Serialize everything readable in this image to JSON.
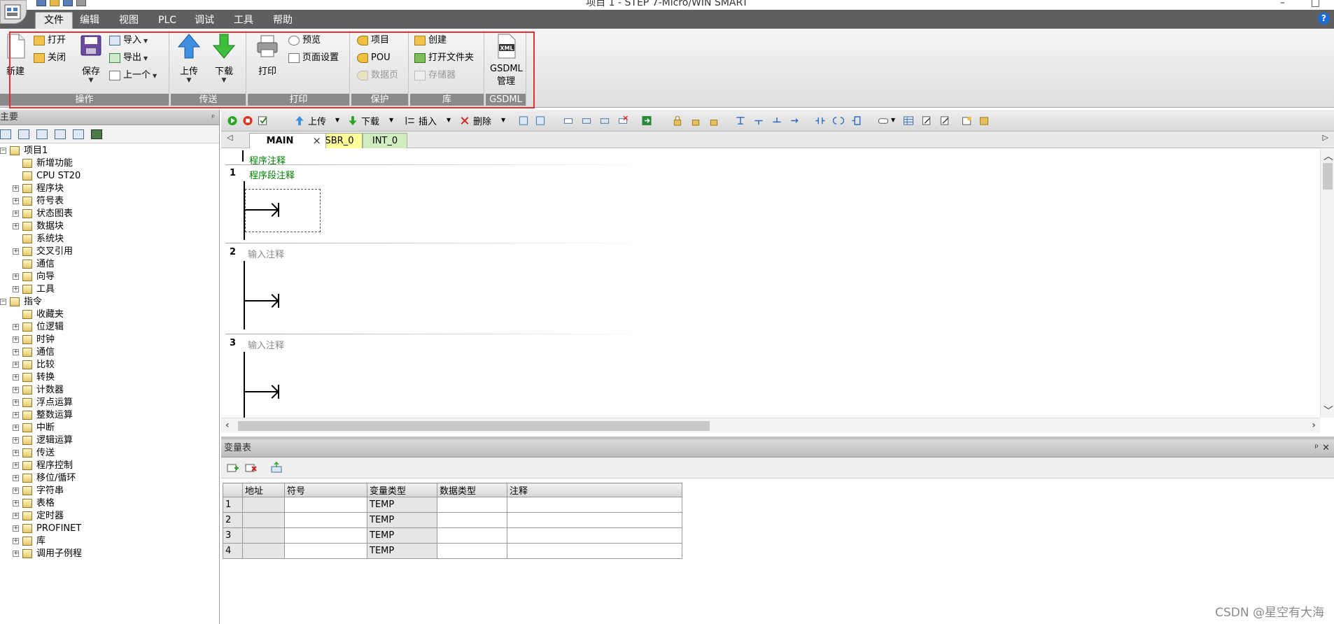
{
  "window": {
    "title": "项目 1 - STEP 7-Micro/WIN SMART",
    "minimize": "–",
    "maximize": "□",
    "help": "?"
  },
  "menu": {
    "items": [
      "文件",
      "编辑",
      "视图",
      "PLC",
      "调试",
      "工具",
      "帮助"
    ],
    "active": "文件"
  },
  "ribbon": {
    "groups": {
      "operate": "操作",
      "transfer": "传送",
      "print": "打印",
      "protect": "保护",
      "library": "库",
      "gsdml": "GSDML"
    },
    "new_label": "新建",
    "open_label": "打开",
    "close_label": "关闭",
    "save_label": "保存",
    "import_label": "导入",
    "export_label": "导出",
    "prev_label": "上一个",
    "upload_label": "上传",
    "download_label": "下载",
    "print_label": "打印",
    "preview_label": "预览",
    "page_setup_label": "页面设置",
    "project_label": "项目",
    "pou_label": "POU",
    "datapage_label": "数据页",
    "create_label": "创建",
    "open_folder_label": "打开文件夹",
    "memory_label": "存储器",
    "gsdml_line1": "GSDML",
    "gsdml_line2": "管理",
    "xml_badge": "XML"
  },
  "left_panel": {
    "title": "主要",
    "pin": "ᵖ",
    "tree": [
      {
        "label": "项目1",
        "level": 0,
        "expander": "−"
      },
      {
        "label": "新增功能",
        "level": 1,
        "expander": ""
      },
      {
        "label": "CPU ST20",
        "level": 1,
        "expander": ""
      },
      {
        "label": "程序块",
        "level": 1,
        "expander": "+"
      },
      {
        "label": "符号表",
        "level": 1,
        "expander": "+"
      },
      {
        "label": "状态图表",
        "level": 1,
        "expander": "+"
      },
      {
        "label": "数据块",
        "level": 1,
        "expander": "+"
      },
      {
        "label": "系统块",
        "level": 1,
        "expander": ""
      },
      {
        "label": "交叉引用",
        "level": 1,
        "expander": "+"
      },
      {
        "label": "通信",
        "level": 1,
        "expander": ""
      },
      {
        "label": "向导",
        "level": 1,
        "expander": "+"
      },
      {
        "label": "工具",
        "level": 1,
        "expander": "+"
      },
      {
        "label": "指令",
        "level": 0,
        "expander": "−"
      },
      {
        "label": "收藏夹",
        "level": 1,
        "expander": ""
      },
      {
        "label": "位逻辑",
        "level": 1,
        "expander": "+"
      },
      {
        "label": "时钟",
        "level": 1,
        "expander": "+"
      },
      {
        "label": "通信",
        "level": 1,
        "expander": "+"
      },
      {
        "label": "比较",
        "level": 1,
        "expander": "+"
      },
      {
        "label": "转换",
        "level": 1,
        "expander": "+"
      },
      {
        "label": "计数器",
        "level": 1,
        "expander": "+"
      },
      {
        "label": "浮点运算",
        "level": 1,
        "expander": "+"
      },
      {
        "label": "整数运算",
        "level": 1,
        "expander": "+"
      },
      {
        "label": "中断",
        "level": 1,
        "expander": "+"
      },
      {
        "label": "逻辑运算",
        "level": 1,
        "expander": "+"
      },
      {
        "label": "传送",
        "level": 1,
        "expander": "+"
      },
      {
        "label": "程序控制",
        "level": 1,
        "expander": "+"
      },
      {
        "label": "移位/循环",
        "level": 1,
        "expander": "+"
      },
      {
        "label": "字符串",
        "level": 1,
        "expander": "+"
      },
      {
        "label": "表格",
        "level": 1,
        "expander": "+"
      },
      {
        "label": "定时器",
        "level": 1,
        "expander": "+"
      },
      {
        "label": "PROFINET",
        "level": 1,
        "expander": "+"
      },
      {
        "label": "库",
        "level": 1,
        "expander": "+"
      },
      {
        "label": "调用子例程",
        "level": 1,
        "expander": "+"
      }
    ]
  },
  "editor": {
    "toolbar": {
      "upload": "上传",
      "download": "下载",
      "insert": "插入",
      "delete": "删除"
    },
    "tabs": [
      "MAIN",
      "SBR_0",
      "INT_0"
    ],
    "tab_close": "×",
    "program_comment": "程序注释",
    "networks": [
      {
        "num": "1",
        "comment": "程序段注释"
      },
      {
        "num": "2",
        "comment": "输入注释"
      },
      {
        "num": "3",
        "comment": "输入注释"
      }
    ]
  },
  "var_table": {
    "title": "变量表",
    "pin": "ᵖ",
    "close": "✕",
    "columns": [
      "",
      "地址",
      "符号",
      "变量类型",
      "数据类型",
      "注释"
    ],
    "rows": [
      {
        "n": "1",
        "addr": "",
        "symbol": "",
        "vartype": "TEMP",
        "datatype": "",
        "comment": ""
      },
      {
        "n": "2",
        "addr": "",
        "symbol": "",
        "vartype": "TEMP",
        "datatype": "",
        "comment": ""
      },
      {
        "n": "3",
        "addr": "",
        "symbol": "",
        "vartype": "TEMP",
        "datatype": "",
        "comment": ""
      },
      {
        "n": "4",
        "addr": "",
        "symbol": "",
        "vartype": "TEMP",
        "datatype": "",
        "comment": ""
      }
    ]
  },
  "watermark": "CSDN @星空有大海"
}
